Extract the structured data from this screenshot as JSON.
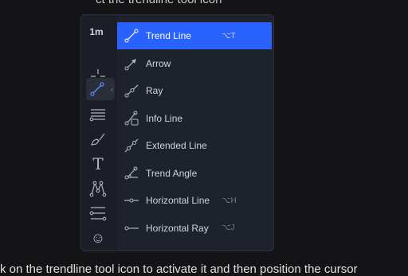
{
  "top_text": "ct the trendline tool icon",
  "toolbar": {
    "interval": "1m",
    "tools": [
      {
        "name": "crosshair-icon"
      },
      {
        "name": "trend-line-tool-icon",
        "active": true,
        "chevron": "‹"
      },
      {
        "name": "fib-retracement-icon"
      },
      {
        "name": "brush-icon"
      },
      {
        "name": "text-tool-icon",
        "glyph": "T"
      },
      {
        "name": "pattern-icon"
      },
      {
        "name": "prediction-icon"
      },
      {
        "name": "emoji-icon",
        "glyph": "☺"
      }
    ]
  },
  "menu": {
    "items": [
      {
        "label": "Trend Line",
        "shortcut": "⌥T",
        "selected": true
      },
      {
        "label": "Arrow",
        "shortcut": ""
      },
      {
        "label": "Ray",
        "shortcut": ""
      },
      {
        "label": "Info Line",
        "shortcut": ""
      },
      {
        "label": "Extended Line",
        "shortcut": ""
      },
      {
        "label": "Trend Angle",
        "shortcut": ""
      },
      {
        "label": "Horizontal Line",
        "shortcut": "⌥H"
      },
      {
        "label": "Horizontal Ray",
        "shortcut": "⌥J"
      }
    ]
  },
  "caption": "k on the trendline tool icon to activate it and then position the cursor",
  "colors": {
    "accent": "#2962ff",
    "panel": "#1e222d",
    "background": "#141416"
  }
}
